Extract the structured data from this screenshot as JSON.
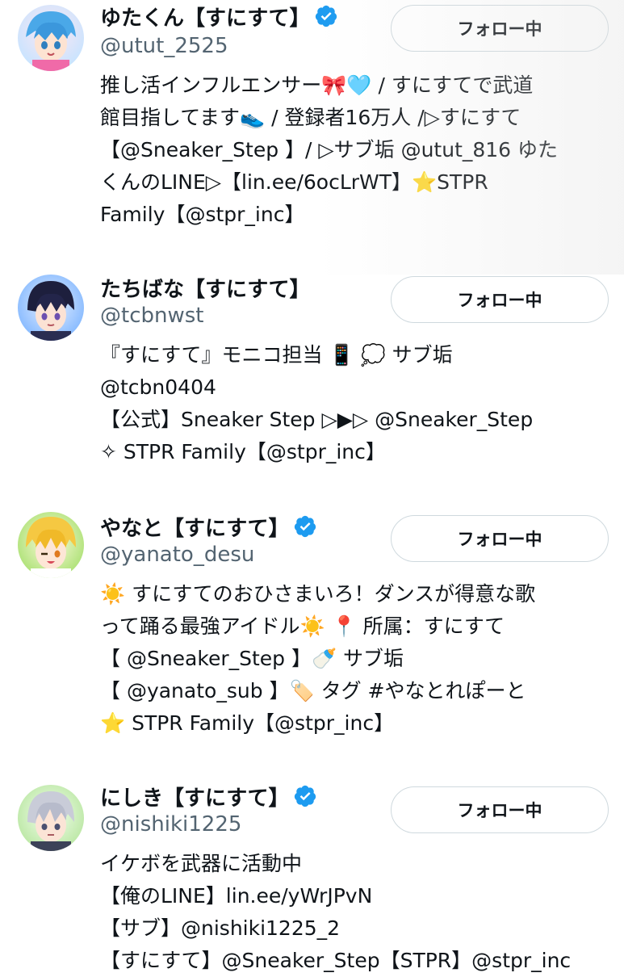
{
  "users": [
    {
      "name": "ゆたくん【すにすて】",
      "handle": "@utut_2525",
      "verified": true,
      "follow_label": "フォロー中",
      "avatar_icon": "avatar-image",
      "bio_lines": [
        "推し活インフルエンサー🎀🩵 / すにすてで武道",
        "館目指してます👟 / 登録者16万人 /▷すにすて",
        "【@Sneaker_Step 】/ ▷サブ垢 @utut_816 ゆた",
        "くんのLINE▷【lin.ee/6ocLrWT】⭐STPR",
        "Family【@stpr_inc】"
      ]
    },
    {
      "name": "たちばな【すにすて】",
      "handle": "@tcbnwst",
      "verified": false,
      "follow_label": "フォロー中",
      "avatar_icon": "avatar-image",
      "bio_lines": [
        "『すにすて』モニコ担当 📱 💭 サブ垢",
        " @tcbn0404",
        "【公式】Sneaker Step ▷▶▷ @Sneaker_Step",
        "✧ STPR Family【@stpr_inc】"
      ]
    },
    {
      "name": "やなと【すにすて】",
      "handle": "@yanato_desu",
      "verified": true,
      "follow_label": "フォロー中",
      "avatar_icon": "avatar-image",
      "bio_lines": [
        "☀️ すにすてのおひさまいろ！ダンスが得意な歌",
        "って踊る最強アイドル☀️  📍 所属：すにすて",
        "【 @Sneaker_Step 】🍼 サブ垢",
        "【 @yanato_sub 】🏷️ タグ #やなとれぽーと",
        "⭐ STPR Family【@stpr_inc】"
      ]
    },
    {
      "name": "にしき【すにすて】",
      "handle": "@nishiki1225",
      "verified": true,
      "follow_label": "フォロー中",
      "avatar_icon": "avatar-image",
      "bio_lines": [
        "イケボを武器に活動中",
        "【俺のLINE】lin.ee/yWrJPvN",
        "【サブ】@nishiki1225_2",
        "【すにすて】@Sneaker_Step【STPR】@stpr_inc"
      ]
    }
  ],
  "colors": {
    "text": "#0f1419",
    "secondary_text": "#536471",
    "verified_badge": "#1d9bf0",
    "button_border": "#cfd9de"
  }
}
